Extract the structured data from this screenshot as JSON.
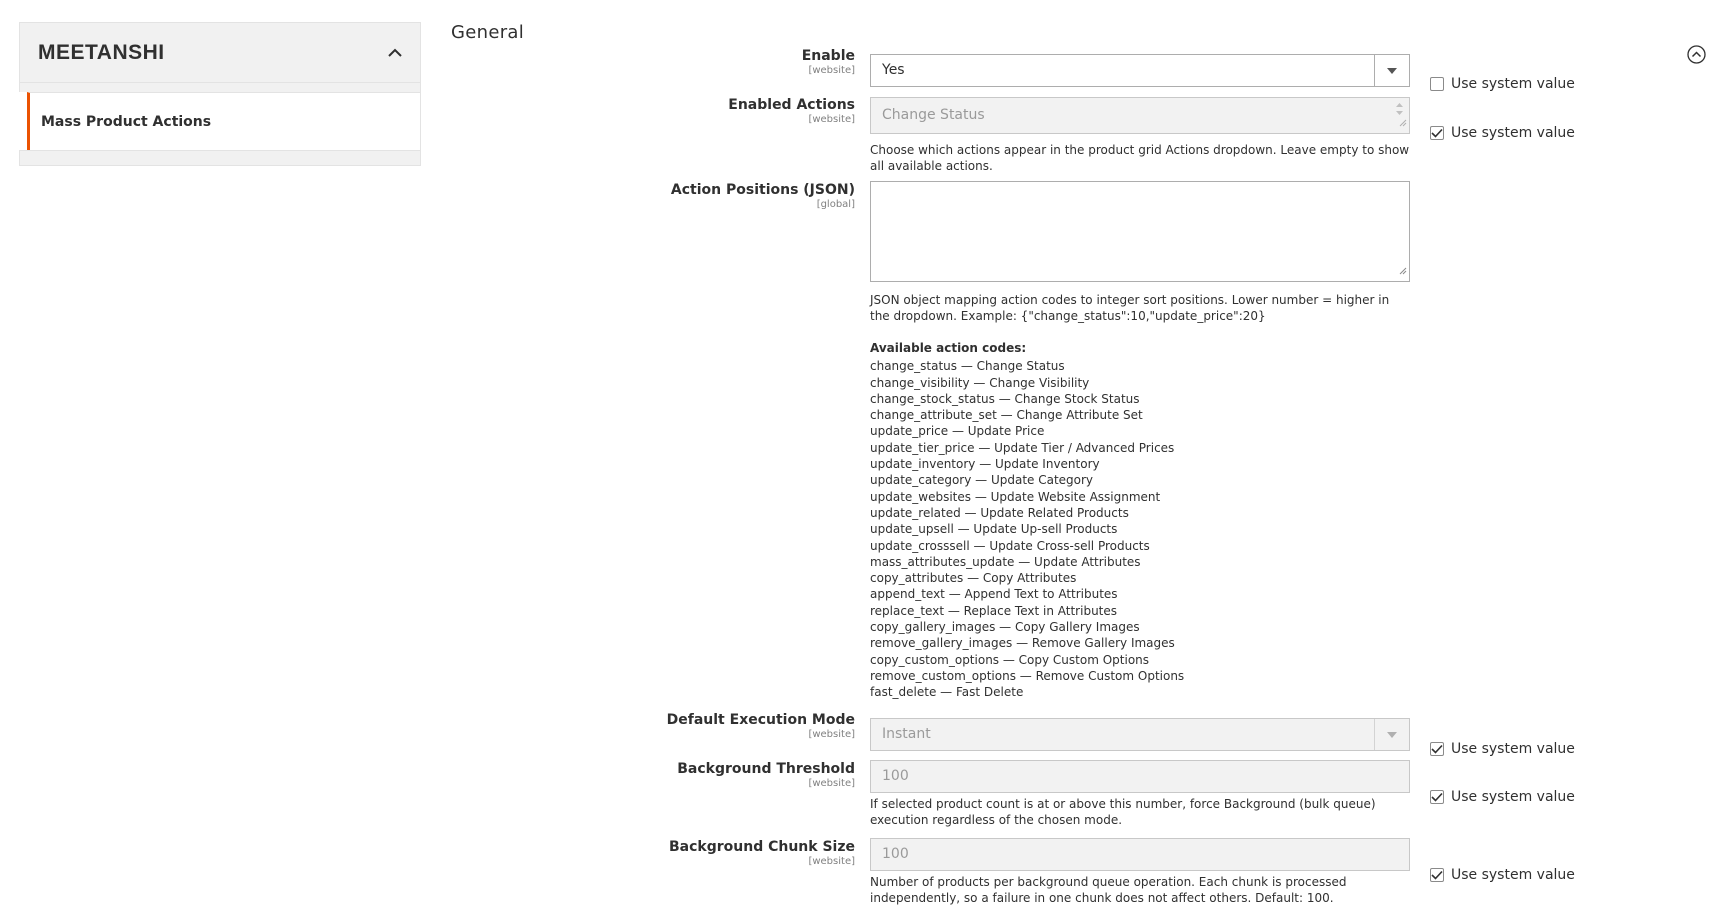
{
  "sidebar": {
    "brand": "MEETANSHI",
    "item": "Mass Product Actions"
  },
  "section": {
    "title": "General"
  },
  "fields": {
    "enable": {
      "label": "Enable",
      "scope": "[website]",
      "value": "Yes",
      "use_system": false
    },
    "enabled_actions": {
      "label": "Enabled Actions",
      "scope": "[website]",
      "value": "Change Status",
      "use_system": true,
      "note": "Choose which actions appear in the product grid Actions dropdown. Leave empty to show all available actions."
    },
    "action_positions": {
      "label": "Action Positions (JSON)",
      "scope": "[global]",
      "value": "",
      "note": "JSON object mapping action codes to integer sort positions. Lower number = higher in the dropdown. Example: {\"change_status\":10,\"update_price\":20}",
      "codes_heading": "Available action codes:",
      "codes": [
        "change_status — Change Status",
        "change_visibility — Change Visibility",
        "change_stock_status — Change Stock Status",
        "change_attribute_set — Change Attribute Set",
        "update_price — Update Price",
        "update_tier_price — Update Tier / Advanced Prices",
        "update_inventory — Update Inventory",
        "update_category — Update Category",
        "update_websites — Update Website Assignment",
        "update_related — Update Related Products",
        "update_upsell — Update Up-sell Products",
        "update_crosssell — Update Cross-sell Products",
        "mass_attributes_update — Update Attributes",
        "copy_attributes — Copy Attributes",
        "append_text — Append Text to Attributes",
        "replace_text — Replace Text in Attributes",
        "copy_gallery_images — Copy Gallery Images",
        "remove_gallery_images — Remove Gallery Images",
        "copy_custom_options — Copy Custom Options",
        "remove_custom_options — Remove Custom Options",
        "fast_delete — Fast Delete"
      ]
    },
    "default_mode": {
      "label": "Default Execution Mode",
      "scope": "[website]",
      "value": "Instant",
      "use_system": true
    },
    "bg_threshold": {
      "label": "Background Threshold",
      "scope": "[website]",
      "value": "100",
      "use_system": true,
      "note": "If selected product count is at or above this number, force Background (bulk queue) execution regardless of the chosen mode."
    },
    "bg_chunk": {
      "label": "Background Chunk Size",
      "scope": "[website]",
      "value": "100",
      "use_system": true,
      "note": "Number of products per background queue operation. Each chunk is processed independently, so a failure in one chunk does not affect others. Default: 100."
    }
  },
  "common": {
    "use_system_label": "Use system value"
  },
  "colors": {
    "accent": "#eb5202",
    "disabled_bg": "#f2f2f2",
    "sidebar_bg": "#f1f1f1"
  },
  "icons": {
    "collapse": "chevron-up-icon",
    "section_toggle": "circle-chevron-up-icon",
    "select": "triangle-down-icon",
    "check": "checkmark-icon"
  }
}
